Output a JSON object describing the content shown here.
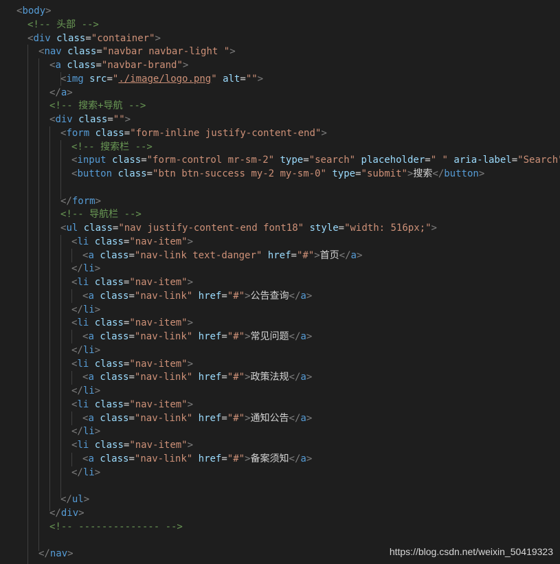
{
  "editor": {
    "lines": [
      [
        [
          "t",
          "<"
        ],
        [
          "n",
          "body"
        ],
        [
          "t",
          ">"
        ]
      ],
      [
        [
          "c",
          "<!-- 头部 -->"
        ]
      ],
      [
        [
          "t",
          "<"
        ],
        [
          "n",
          "div"
        ],
        [
          "x",
          " "
        ],
        [
          "a",
          "class"
        ],
        [
          "x",
          "="
        ],
        [
          "v",
          "\"container\""
        ],
        [
          "t",
          ">"
        ]
      ],
      [
        [
          "t",
          "<"
        ],
        [
          "n",
          "nav"
        ],
        [
          "x",
          " "
        ],
        [
          "a",
          "class"
        ],
        [
          "x",
          "="
        ],
        [
          "v",
          "\"navbar navbar-light \""
        ],
        [
          "t",
          ">"
        ]
      ],
      [
        [
          "t",
          "<"
        ],
        [
          "n",
          "a"
        ],
        [
          "x",
          " "
        ],
        [
          "a",
          "class"
        ],
        [
          "x",
          "="
        ],
        [
          "v",
          "\"navbar-brand\""
        ],
        [
          "t",
          ">"
        ]
      ],
      [
        [
          "t",
          "<"
        ],
        [
          "n",
          "img"
        ],
        [
          "x",
          " "
        ],
        [
          "a",
          "src"
        ],
        [
          "x",
          "="
        ],
        [
          "v",
          "\""
        ],
        [
          "u",
          "./image/logo.png"
        ],
        [
          "v",
          "\""
        ],
        [
          "x",
          " "
        ],
        [
          "a",
          "alt"
        ],
        [
          "x",
          "="
        ],
        [
          "v",
          "\"\""
        ],
        [
          "t",
          ">"
        ]
      ],
      [
        [
          "t",
          "</"
        ],
        [
          "n",
          "a"
        ],
        [
          "t",
          ">"
        ]
      ],
      [
        [
          "c",
          "<!-- 搜索+导航 -->"
        ]
      ],
      [
        [
          "t",
          "<"
        ],
        [
          "n",
          "div"
        ],
        [
          "x",
          " "
        ],
        [
          "a",
          "class"
        ],
        [
          "x",
          "="
        ],
        [
          "v",
          "\"\""
        ],
        [
          "t",
          ">"
        ]
      ],
      [
        [
          "t",
          "<"
        ],
        [
          "n",
          "form"
        ],
        [
          "x",
          " "
        ],
        [
          "a",
          "class"
        ],
        [
          "x",
          "="
        ],
        [
          "v",
          "\"form-inline justify-content-end\""
        ],
        [
          "t",
          ">"
        ]
      ],
      [
        [
          "c",
          "<!-- 搜索栏 -->"
        ]
      ],
      [
        [
          "t",
          "<"
        ],
        [
          "n",
          "input"
        ],
        [
          "x",
          " "
        ],
        [
          "a",
          "class"
        ],
        [
          "x",
          "="
        ],
        [
          "v",
          "\"form-control mr-sm-2\""
        ],
        [
          "x",
          " "
        ],
        [
          "a",
          "type"
        ],
        [
          "x",
          "="
        ],
        [
          "v",
          "\"search\""
        ],
        [
          "x",
          " "
        ],
        [
          "a",
          "placeholder"
        ],
        [
          "x",
          "="
        ],
        [
          "v",
          "\" \""
        ],
        [
          "x",
          " "
        ],
        [
          "a",
          "aria-label"
        ],
        [
          "x",
          "="
        ],
        [
          "v",
          "\"Search\""
        ],
        [
          "t",
          ">"
        ]
      ],
      [
        [
          "t",
          "<"
        ],
        [
          "n",
          "button"
        ],
        [
          "x",
          " "
        ],
        [
          "a",
          "class"
        ],
        [
          "x",
          "="
        ],
        [
          "v",
          "\"btn btn-success my-2 my-sm-0\""
        ],
        [
          "x",
          " "
        ],
        [
          "a",
          "type"
        ],
        [
          "x",
          "="
        ],
        [
          "v",
          "\"submit\""
        ],
        [
          "t",
          ">"
        ],
        [
          "x",
          "搜索"
        ],
        [
          "t",
          "</"
        ],
        [
          "n",
          "button"
        ],
        [
          "t",
          ">"
        ]
      ],
      [],
      [
        [
          "t",
          "</"
        ],
        [
          "n",
          "form"
        ],
        [
          "t",
          ">"
        ]
      ],
      [
        [
          "c",
          "<!-- 导航栏 -->"
        ]
      ],
      [
        [
          "t",
          "<"
        ],
        [
          "n",
          "ul"
        ],
        [
          "x",
          " "
        ],
        [
          "a",
          "class"
        ],
        [
          "x",
          "="
        ],
        [
          "v",
          "\"nav justify-content-end font18\""
        ],
        [
          "x",
          " "
        ],
        [
          "a",
          "style"
        ],
        [
          "x",
          "="
        ],
        [
          "v",
          "\"width: 516px;\""
        ],
        [
          "t",
          ">"
        ]
      ],
      [
        [
          "t",
          "<"
        ],
        [
          "n",
          "li"
        ],
        [
          "x",
          " "
        ],
        [
          "a",
          "class"
        ],
        [
          "x",
          "="
        ],
        [
          "v",
          "\"nav-item\""
        ],
        [
          "t",
          ">"
        ]
      ],
      [
        [
          "t",
          "<"
        ],
        [
          "n",
          "a"
        ],
        [
          "x",
          " "
        ],
        [
          "a",
          "class"
        ],
        [
          "x",
          "="
        ],
        [
          "v",
          "\"nav-link text-danger\""
        ],
        [
          "x",
          " "
        ],
        [
          "a",
          "href"
        ],
        [
          "x",
          "="
        ],
        [
          "v",
          "\"#\""
        ],
        [
          "t",
          ">"
        ],
        [
          "x",
          "首页"
        ],
        [
          "t",
          "</"
        ],
        [
          "n",
          "a"
        ],
        [
          "t",
          ">"
        ]
      ],
      [
        [
          "t",
          "</"
        ],
        [
          "n",
          "li"
        ],
        [
          "t",
          ">"
        ]
      ],
      [
        [
          "t",
          "<"
        ],
        [
          "n",
          "li"
        ],
        [
          "x",
          " "
        ],
        [
          "a",
          "class"
        ],
        [
          "x",
          "="
        ],
        [
          "v",
          "\"nav-item\""
        ],
        [
          "t",
          ">"
        ]
      ],
      [
        [
          "t",
          "<"
        ],
        [
          "n",
          "a"
        ],
        [
          "x",
          " "
        ],
        [
          "a",
          "class"
        ],
        [
          "x",
          "="
        ],
        [
          "v",
          "\"nav-link\""
        ],
        [
          "x",
          " "
        ],
        [
          "a",
          "href"
        ],
        [
          "x",
          "="
        ],
        [
          "v",
          "\"#\""
        ],
        [
          "t",
          ">"
        ],
        [
          "x",
          "公告查询"
        ],
        [
          "t",
          "</"
        ],
        [
          "n",
          "a"
        ],
        [
          "t",
          ">"
        ]
      ],
      [
        [
          "t",
          "</"
        ],
        [
          "n",
          "li"
        ],
        [
          "t",
          ">"
        ]
      ],
      [
        [
          "t",
          "<"
        ],
        [
          "n",
          "li"
        ],
        [
          "x",
          " "
        ],
        [
          "a",
          "class"
        ],
        [
          "x",
          "="
        ],
        [
          "v",
          "\"nav-item\""
        ],
        [
          "t",
          ">"
        ]
      ],
      [
        [
          "t",
          "<"
        ],
        [
          "n",
          "a"
        ],
        [
          "x",
          " "
        ],
        [
          "a",
          "class"
        ],
        [
          "x",
          "="
        ],
        [
          "v",
          "\"nav-link\""
        ],
        [
          "x",
          " "
        ],
        [
          "a",
          "href"
        ],
        [
          "x",
          "="
        ],
        [
          "v",
          "\"#\""
        ],
        [
          "t",
          ">"
        ],
        [
          "x",
          "常见问题"
        ],
        [
          "t",
          "</"
        ],
        [
          "n",
          "a"
        ],
        [
          "t",
          ">"
        ]
      ],
      [
        [
          "t",
          "</"
        ],
        [
          "n",
          "li"
        ],
        [
          "t",
          ">"
        ]
      ],
      [
        [
          "t",
          "<"
        ],
        [
          "n",
          "li"
        ],
        [
          "x",
          " "
        ],
        [
          "a",
          "class"
        ],
        [
          "x",
          "="
        ],
        [
          "v",
          "\"nav-item\""
        ],
        [
          "t",
          ">"
        ]
      ],
      [
        [
          "t",
          "<"
        ],
        [
          "n",
          "a"
        ],
        [
          "x",
          " "
        ],
        [
          "a",
          "class"
        ],
        [
          "x",
          "="
        ],
        [
          "v",
          "\"nav-link\""
        ],
        [
          "x",
          " "
        ],
        [
          "a",
          "href"
        ],
        [
          "x",
          "="
        ],
        [
          "v",
          "\"#\""
        ],
        [
          "t",
          ">"
        ],
        [
          "x",
          "政策法规"
        ],
        [
          "t",
          "</"
        ],
        [
          "n",
          "a"
        ],
        [
          "t",
          ">"
        ]
      ],
      [
        [
          "t",
          "</"
        ],
        [
          "n",
          "li"
        ],
        [
          "t",
          ">"
        ]
      ],
      [
        [
          "t",
          "<"
        ],
        [
          "n",
          "li"
        ],
        [
          "x",
          " "
        ],
        [
          "a",
          "class"
        ],
        [
          "x",
          "="
        ],
        [
          "v",
          "\"nav-item\""
        ],
        [
          "t",
          ">"
        ]
      ],
      [
        [
          "t",
          "<"
        ],
        [
          "n",
          "a"
        ],
        [
          "x",
          " "
        ],
        [
          "a",
          "class"
        ],
        [
          "x",
          "="
        ],
        [
          "v",
          "\"nav-link\""
        ],
        [
          "x",
          " "
        ],
        [
          "a",
          "href"
        ],
        [
          "x",
          "="
        ],
        [
          "v",
          "\"#\""
        ],
        [
          "t",
          ">"
        ],
        [
          "x",
          "通知公告"
        ],
        [
          "t",
          "</"
        ],
        [
          "n",
          "a"
        ],
        [
          "t",
          ">"
        ]
      ],
      [
        [
          "t",
          "</"
        ],
        [
          "n",
          "li"
        ],
        [
          "t",
          ">"
        ]
      ],
      [
        [
          "t",
          "<"
        ],
        [
          "n",
          "li"
        ],
        [
          "x",
          " "
        ],
        [
          "a",
          "class"
        ],
        [
          "x",
          "="
        ],
        [
          "v",
          "\"nav-item\""
        ],
        [
          "t",
          ">"
        ]
      ],
      [
        [
          "t",
          "<"
        ],
        [
          "n",
          "a"
        ],
        [
          "x",
          " "
        ],
        [
          "a",
          "class"
        ],
        [
          "x",
          "="
        ],
        [
          "v",
          "\"nav-link\""
        ],
        [
          "x",
          " "
        ],
        [
          "a",
          "href"
        ],
        [
          "x",
          "="
        ],
        [
          "v",
          "\"#\""
        ],
        [
          "t",
          ">"
        ],
        [
          "x",
          "备案须知"
        ],
        [
          "t",
          "</"
        ],
        [
          "n",
          "a"
        ],
        [
          "t",
          ">"
        ]
      ],
      [
        [
          "t",
          "</"
        ],
        [
          "n",
          "li"
        ],
        [
          "t",
          ">"
        ]
      ],
      [],
      [
        [
          "t",
          "</"
        ],
        [
          "n",
          "ul"
        ],
        [
          "t",
          ">"
        ]
      ],
      [
        [
          "t",
          "</"
        ],
        [
          "n",
          "div"
        ],
        [
          "t",
          ">"
        ]
      ],
      [
        [
          "c",
          "<!-- -------------- -->"
        ]
      ],
      [],
      [
        [
          "t",
          "</"
        ],
        [
          "n",
          "nav"
        ],
        [
          "t",
          ">"
        ]
      ]
    ]
  },
  "colors": {
    "background": "#1e1e1e",
    "tag_bracket": "#808080",
    "tag_name": "#569cd6",
    "attribute": "#9cdcfe",
    "string": "#ce9178",
    "comment": "#6a9955",
    "text": "#d4d4d4"
  },
  "watermark": "https://blog.csdn.net/weixin_50419323"
}
